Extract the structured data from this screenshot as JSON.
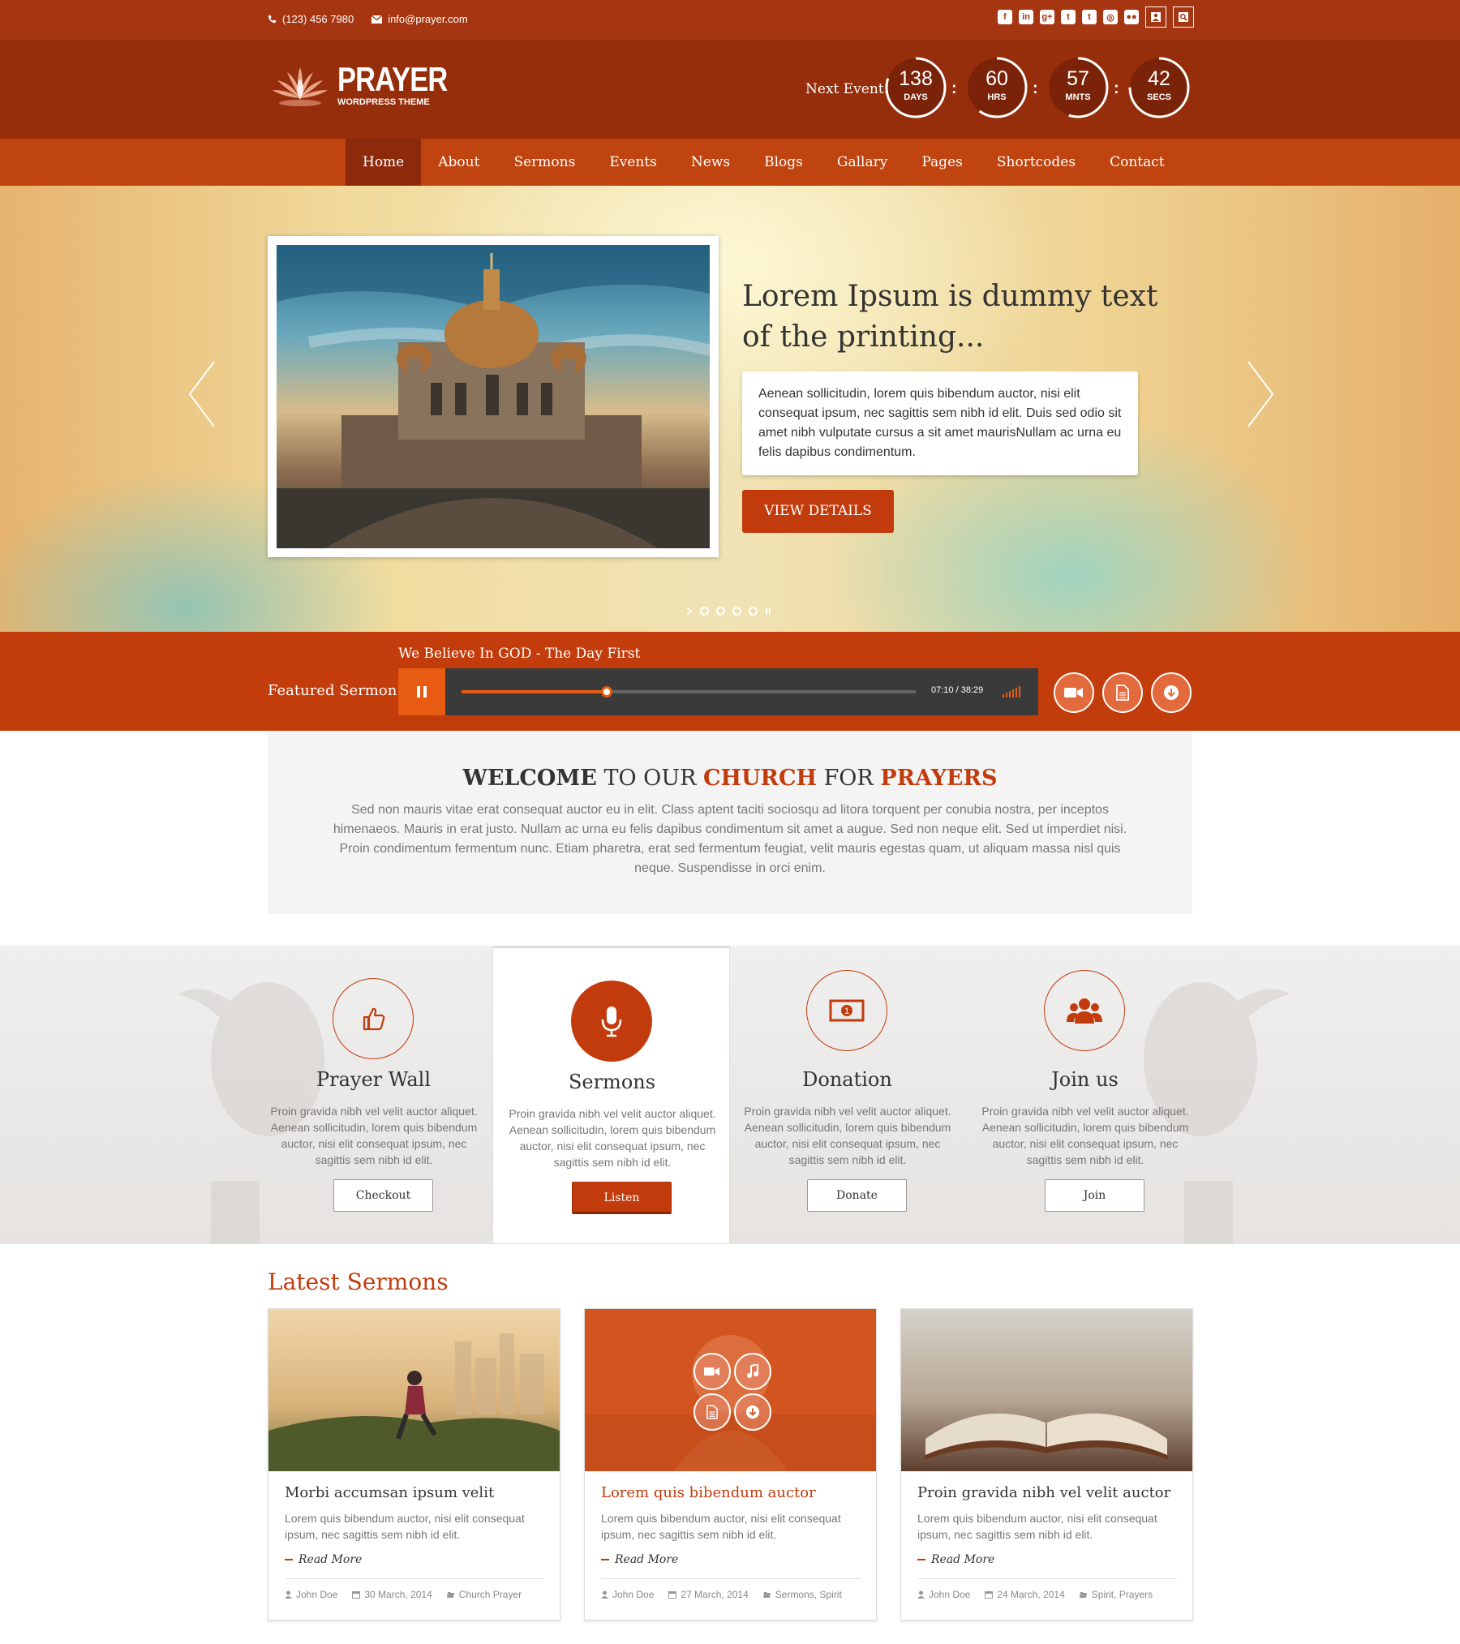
{
  "topbar": {
    "phone": "(123) 456 7980",
    "email": "info@prayer.com",
    "social": [
      "facebook-icon",
      "linkedin-icon",
      "google-plus-icon",
      "twitter-icon",
      "tumblr-icon",
      "instagram-icon",
      "flickr-icon"
    ]
  },
  "header": {
    "logo_title": "PRAYER",
    "logo_sub": "WORDPRESS THEME",
    "next_event_label": "Next Event:",
    "countdown": [
      {
        "value": "138",
        "unit": "DAYS",
        "fraction": 0.8
      },
      {
        "value": "60",
        "unit": "HRS",
        "fraction": 0.6
      },
      {
        "value": "57",
        "unit": "MNTS",
        "fraction": 0.55
      },
      {
        "value": "42",
        "unit": "SECS",
        "fraction": 0.75
      }
    ]
  },
  "nav": {
    "items": [
      "Home",
      "About",
      "Sermons",
      "Events",
      "News",
      "Blogs",
      "Gallary",
      "Pages",
      "Shortcodes",
      "Contact"
    ],
    "active": "Home"
  },
  "slider": {
    "title": "Lorem Ipsum is dummy text of the printing...",
    "text": "Aenean sollicitudin, lorem quis bibendum auctor, nisi elit consequat ipsum, nec sagittis sem nibh id elit. Duis sed odio sit amet nibh vulputate cursus a sit amet maurisNullam ac urna eu felis dapibus condimentum.",
    "button": "VIEW DETAILS",
    "dot_count": 4
  },
  "sermon_bar": {
    "label": "Featured Sermon",
    "title": "We Believe In GOD -  The Day First",
    "time": "07:10 / 38:29",
    "progress": 0.32,
    "accent": "#c23c0c"
  },
  "welcome": {
    "w1": "WELCOME",
    "w2": " TO OUR ",
    "w3": "CHURCH",
    "w4": " FOR ",
    "w5": "PRAYERS",
    "text": "Sed non  mauris vitae erat consequat auctor eu in elit. Class aptent taciti sociosqu ad litora torquent per conubia nostra, per inceptos himenaeos. Mauris in erat justo. Nullam ac urna eu felis dapibus condimentum sit amet a augue. Sed non neque elit. Sed ut imperdiet nisi. Proin condimentum fermentum nunc. Etiam pharetra, erat sed fermentum feugiat, velit mauris egestas quam, ut aliquam massa nisl quis neque. Suspendisse in orci enim."
  },
  "features": [
    {
      "icon": "thumbs-up-icon",
      "title": "Prayer Wall",
      "text": "Proin gravida nibh vel velit auctor aliquet. Aenean sollicitudin, lorem quis bibendum auctor, nisi elit consequat ipsum, nec sagittis sem nibh id elit.",
      "button": "Checkout"
    },
    {
      "icon": "microphone-icon",
      "title": "Sermons",
      "text": "Proin gravida nibh vel velit auctor aliquet. Aenean sollicitudin, lorem quis bibendum auctor, nisi elit consequat ipsum, nec sagittis sem nibh id elit.",
      "button": "Listen"
    },
    {
      "icon": "money-icon",
      "title": "Donation",
      "text": "Proin gravida nibh vel velit auctor aliquet. Aenean sollicitudin, lorem quis bibendum auctor, nisi elit consequat ipsum, nec sagittis sem nibh id elit.",
      "button": "Donate"
    },
    {
      "icon": "users-icon",
      "title": "Join us",
      "text": "Proin gravida nibh vel velit auctor aliquet. Aenean sollicitudin, lorem quis bibendum auctor, nisi elit consequat ipsum, nec sagittis sem nibh id elit.",
      "button": "Join"
    }
  ],
  "latest": {
    "title": "Latest Sermons",
    "read_more": "Read More",
    "cards": [
      {
        "title": "Morbi accumsan ipsum velit",
        "text": "Lorem quis bibendum auctor, nisi elit consequat ipsum, nec sagittis sem nibh id elit.",
        "author": "John Doe",
        "date": "30 March, 2014",
        "category": "Church Prayer"
      },
      {
        "title": "Lorem quis bibendum auctor",
        "text": "Lorem quis bibendum auctor, nisi elit consequat ipsum, nec sagittis sem nibh id elit.",
        "author": "John Doe",
        "date": "27 March, 2014",
        "category": "Sermons, Spirit"
      },
      {
        "title": "Proin gravida nibh vel velit auctor",
        "text": "Lorem quis bibendum auctor, nisi elit consequat ipsum, nec sagittis sem nibh id elit.",
        "author": "John Doe",
        "date": "24 March, 2014",
        "category": "Spirit, Prayers"
      }
    ]
  }
}
